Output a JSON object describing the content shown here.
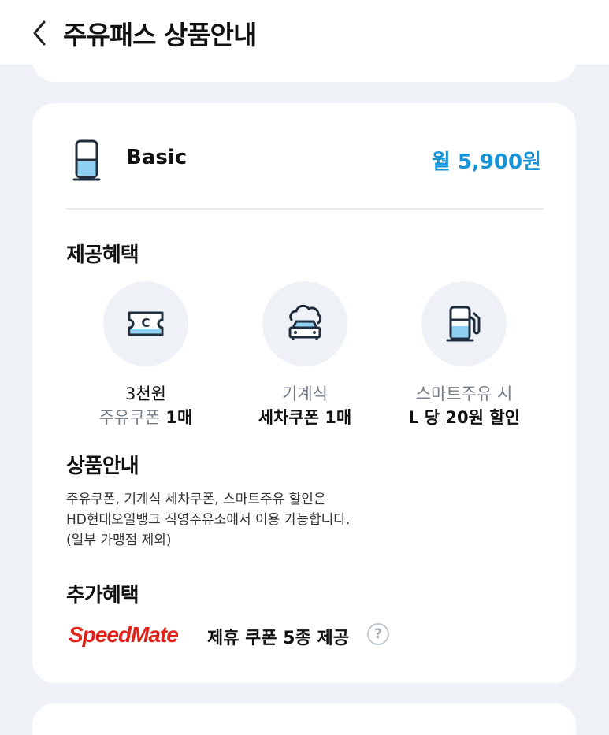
{
  "header": {
    "title": "주유패스 상품안내",
    "back_icon": "chevron-left-icon"
  },
  "plan": {
    "name": "Basic",
    "price": "월 5,900원",
    "icon": "fuel-pump-icon",
    "accent_color": "#1795d8"
  },
  "benefits_section": {
    "title": "제공혜택",
    "items": [
      {
        "icon": "ticket-coupon-icon",
        "line1": "3천원",
        "line2_muted": "주유쿠폰",
        "line2_strong": " 1매"
      },
      {
        "icon": "car-wash-icon",
        "line1": "기계식",
        "line2_muted": "",
        "line2_strong": "세차쿠폰 1매"
      },
      {
        "icon": "fuel-pump-icon",
        "line1": "스마트주유 시",
        "line2_muted": "",
        "line2_strong": "L 당 20원 할인"
      }
    ]
  },
  "product_info": {
    "title": "상품안내",
    "lines": [
      "주유쿠폰, 기계식 세차쿠폰, 스마트주유 할인은",
      "HD현대오일뱅크 직영주유소에서 이용 가능합니다.",
      "(일부 가맹점 제외)"
    ]
  },
  "extra_benefits": {
    "title": "추가혜택",
    "logo_text": "SpeedMate",
    "text": "제휴 쿠폰 5종 제공",
    "help_label": "?",
    "logo_color": "#e2231a"
  }
}
